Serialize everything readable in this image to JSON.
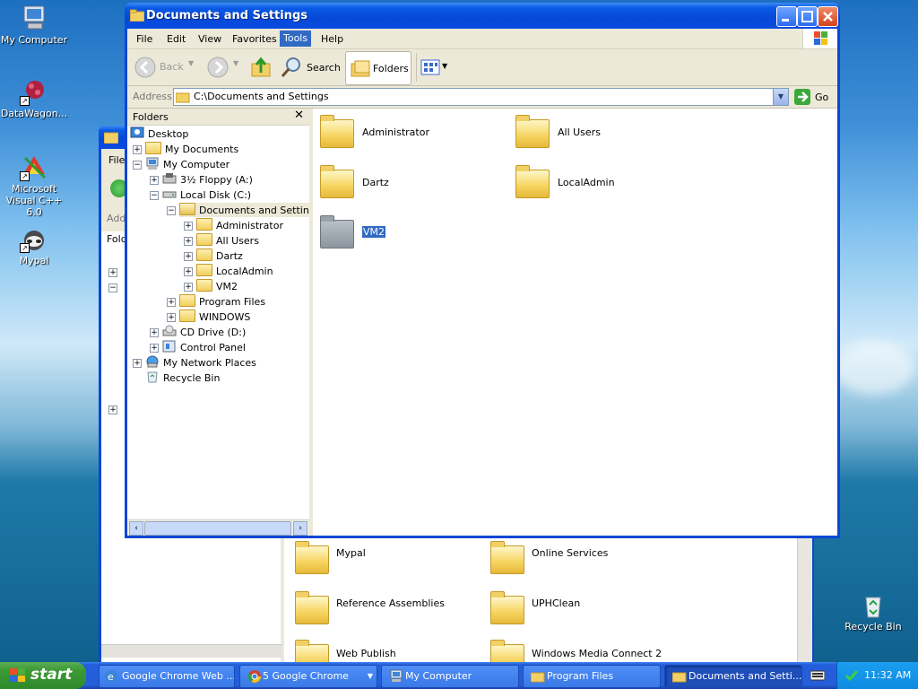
{
  "desktop": {
    "icons": [
      {
        "label": "My Computer"
      },
      {
        "label": "DataWagon..."
      },
      {
        "label": "Microsoft Visual C++ 6.0"
      },
      {
        "label": "Mypal"
      },
      {
        "label": "Recycle Bin"
      }
    ]
  },
  "back_window": {
    "menu_first": "File",
    "address_label": "Add",
    "folders_label": "Fold",
    "items": [
      {
        "label": "Mypal"
      },
      {
        "label": "Online Services"
      },
      {
        "label": "Reference Assemblies"
      },
      {
        "label": "UPHClean"
      },
      {
        "label": "Web Publish"
      },
      {
        "label": "Windows Media Connect 2"
      }
    ]
  },
  "window": {
    "title": "Documents and Settings",
    "menu": [
      "File",
      "Edit",
      "View",
      "Favorites",
      "Tools",
      "Help"
    ],
    "active_menu": "Tools",
    "toolbar": {
      "back": "Back",
      "search": "Search",
      "folders": "Folders"
    },
    "address": {
      "label": "Address",
      "value": "C:\\Documents and Settings",
      "go": "Go"
    },
    "folders_pane": {
      "title": "Folders",
      "tree": [
        {
          "label": "Desktop"
        },
        {
          "label": "My Documents"
        },
        {
          "label": "My Computer"
        },
        {
          "label": "3½ Floppy (A:)"
        },
        {
          "label": "Local Disk (C:)"
        },
        {
          "label": "Documents and Settings"
        },
        {
          "label": "Administrator"
        },
        {
          "label": "All Users"
        },
        {
          "label": "Dartz"
        },
        {
          "label": "LocalAdmin"
        },
        {
          "label": "VM2"
        },
        {
          "label": "Program Files"
        },
        {
          "label": "WINDOWS"
        },
        {
          "label": "CD Drive (D:)"
        },
        {
          "label": "Control Panel"
        },
        {
          "label": "My Network Places"
        },
        {
          "label": "Recycle Bin"
        }
      ]
    },
    "content": [
      {
        "label": "Administrator"
      },
      {
        "label": "All Users"
      },
      {
        "label": "Dartz"
      },
      {
        "label": "LocalAdmin"
      },
      {
        "label": "VM2"
      }
    ]
  },
  "taskbar": {
    "start": "start",
    "tasks": [
      {
        "label": "Google Chrome Web ..."
      },
      {
        "label": "5 Google Chrome"
      },
      {
        "label": "My Computer"
      },
      {
        "label": "Program Files"
      },
      {
        "label": "Documents and Setti..."
      }
    ],
    "clock": "11:32 AM"
  }
}
